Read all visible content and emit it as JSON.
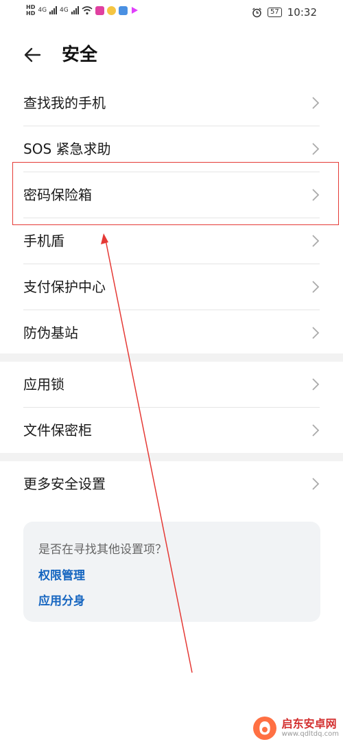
{
  "status_bar": {
    "sim1": "HD",
    "sim2": "HD",
    "net1": "4G",
    "net2": "4G",
    "battery": "57",
    "time": "10:32"
  },
  "header": {
    "title": "安全"
  },
  "group1": [
    {
      "label": "查找我的手机"
    },
    {
      "label": "SOS 紧急求助"
    },
    {
      "label": "密码保险箱"
    },
    {
      "label": "手机盾"
    },
    {
      "label": "支付保护中心"
    },
    {
      "label": "防伪基站"
    }
  ],
  "group2": [
    {
      "label": "应用锁"
    },
    {
      "label": "文件保密柜"
    }
  ],
  "group3": [
    {
      "label": "更多安全设置"
    }
  ],
  "suggestion": {
    "title": "是否在寻找其他设置项？",
    "links": [
      "权限管理",
      "应用分身"
    ]
  },
  "watermark": {
    "name": "启东安卓网",
    "url": "www.qdltdq.com"
  },
  "colors": {
    "accent": "#1565c0",
    "annotation": "#e53935",
    "divider": "#f2f2f2"
  }
}
